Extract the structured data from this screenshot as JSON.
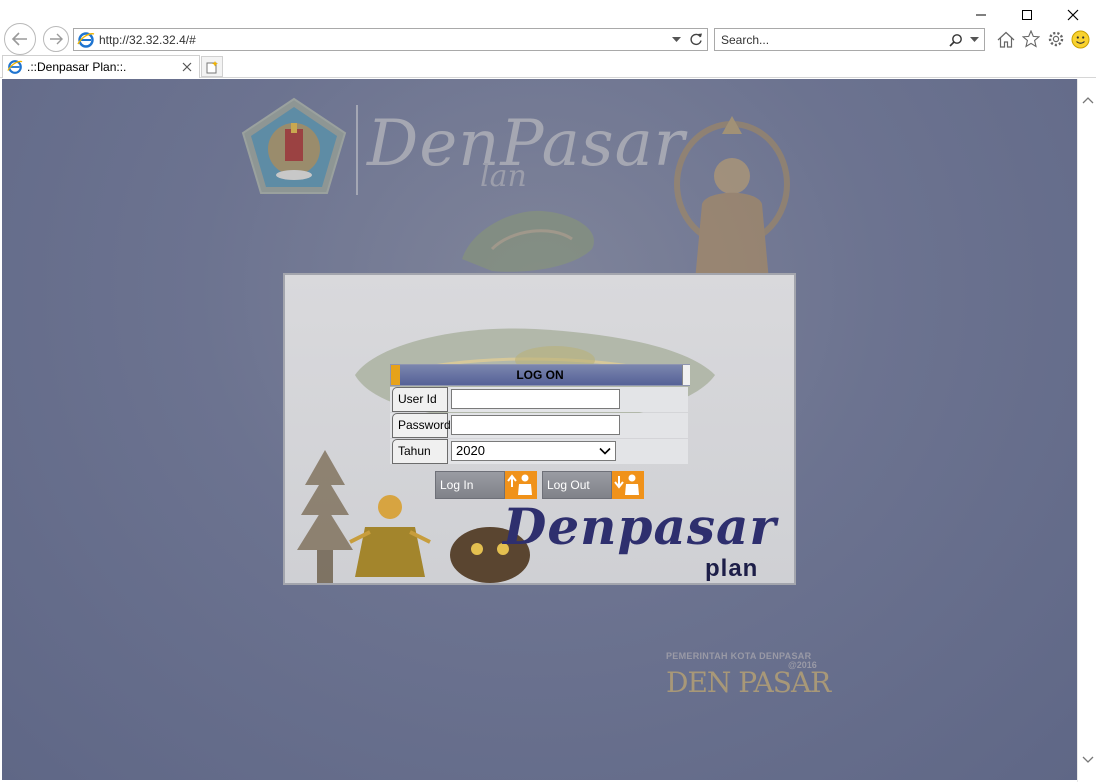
{
  "browser": {
    "url": "http://32.32.32.4/#",
    "search_placeholder": "Search...",
    "tab_title": ".::Denpasar Plan::."
  },
  "page": {
    "brand_title": "DenPasar",
    "brand_sub": "lan",
    "panel_brand": "Denpasar",
    "panel_brand_sub": "plan",
    "footer_gov": "PEMERINTAH KOTA DENPASAR",
    "footer_year": "@2016",
    "footer_logo": "DEN PASAR"
  },
  "login": {
    "heading": "LOG ON",
    "user_label": "User Id",
    "user_value": "",
    "password_label": "Password",
    "password_value": "",
    "year_label": "Tahun",
    "year_value": "2020",
    "login_button": "Log In",
    "logout_button": "Log Out"
  },
  "colors": {
    "page_bg": "#6c7390",
    "header_bar": "#556197",
    "header_accent": "#e6a21b",
    "button_icon": "#f0921a",
    "brand_text": "#2e2f6e"
  }
}
